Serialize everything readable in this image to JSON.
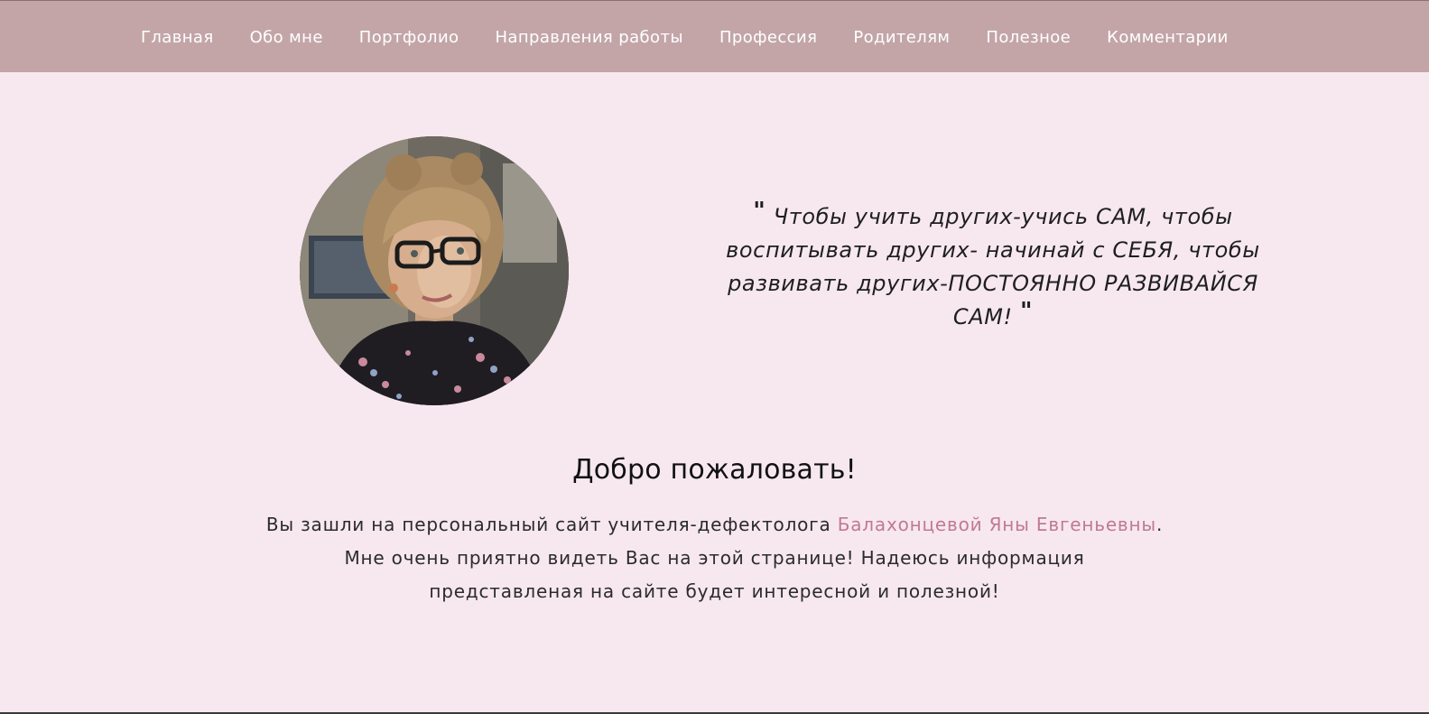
{
  "nav": {
    "items": [
      {
        "label": "Главная"
      },
      {
        "label": "Обо мне"
      },
      {
        "label": "Портфолио"
      },
      {
        "label": "Направления работы"
      },
      {
        "label": "Профессия"
      },
      {
        "label": "Родителям"
      },
      {
        "label": "Полезное"
      },
      {
        "label": "Комментарии"
      }
    ]
  },
  "hero": {
    "quote_open": "\"",
    "quote_line1": "Чтобы учить других-учись САМ, чтобы",
    "quote_line2": "воспитывать других- начинай с СЕБЯ, чтобы",
    "quote_line3": "развивать других-ПОСТОЯННО РАЗВИВАЙСЯ",
    "quote_line4": "САМ!",
    "quote_close": "\""
  },
  "welcome": {
    "title": "Добро пожаловать!",
    "line1_before": "Вы зашли на персональный сайт учителя-дефектолога",
    "name": "Балахонцевой Яны Евгеньевны",
    "line1_after": ".",
    "line2": "Мне очень приятно видеть Вас на этой странице! Надеюсь информация",
    "line3": "представленая на сайте будет интересной и полезной!"
  },
  "colors": {
    "topbar": "#c3a5a8",
    "background": "#f7e8ef",
    "accent": "#c07a92"
  }
}
